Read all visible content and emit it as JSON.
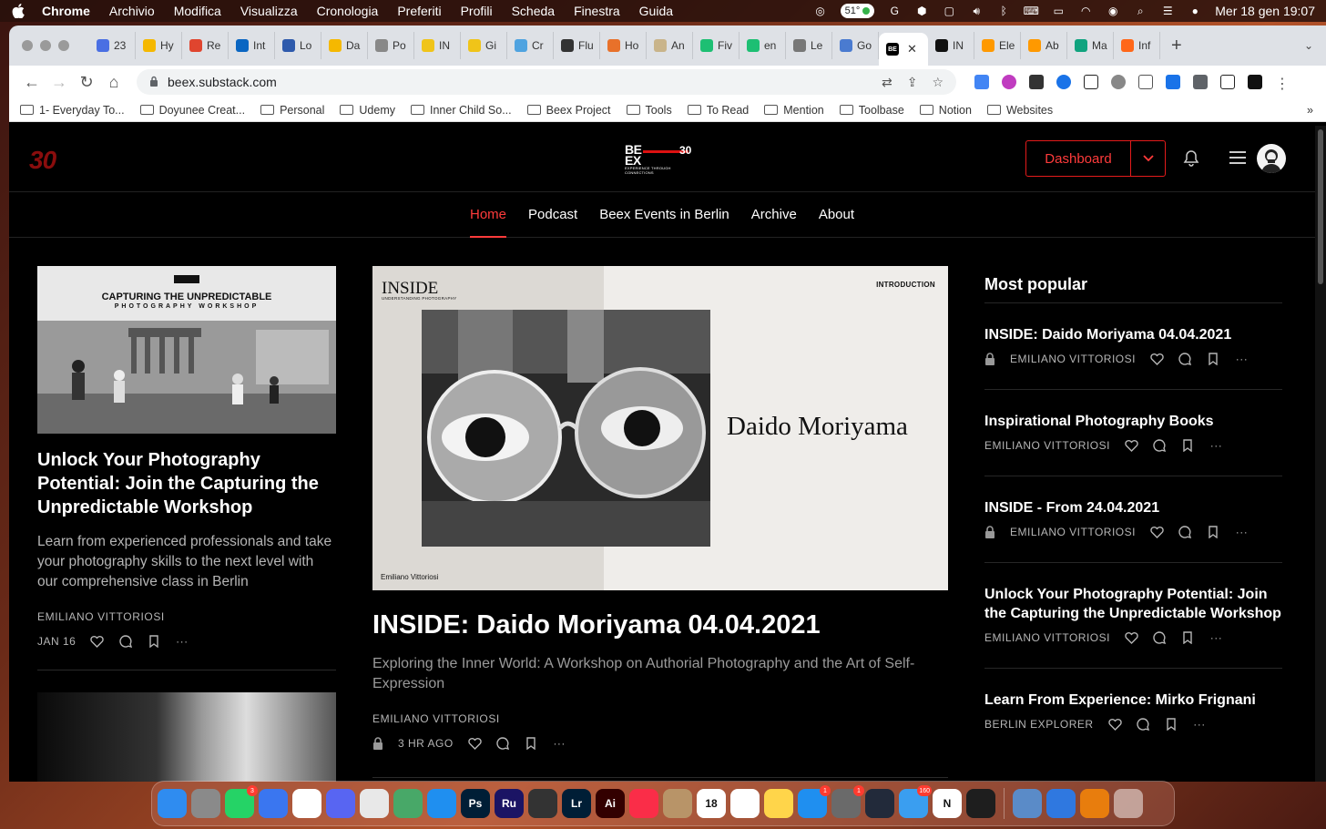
{
  "menubar": {
    "app": "Chrome",
    "items": [
      "Archivio",
      "Modifica",
      "Visualizza",
      "Cronologia",
      "Preferiti",
      "Profili",
      "Scheda",
      "Finestra",
      "Guida"
    ],
    "temperature": "51°",
    "datetime": "Mer 18 gen  19:07"
  },
  "tabs": [
    {
      "label": "23",
      "color": "#4a6fe3"
    },
    {
      "label": "Hy",
      "color": "#f5b800"
    },
    {
      "label": "Re",
      "color": "#e0452f"
    },
    {
      "label": "Int",
      "color": "#0a66c2"
    },
    {
      "label": "Lo",
      "color": "#2e5aac"
    },
    {
      "label": "Da",
      "color": "#f5b800"
    },
    {
      "label": "Po",
      "color": "#888888"
    },
    {
      "label": "IN",
      "color": "#f0c419"
    },
    {
      "label": "Gi",
      "color": "#f0c419"
    },
    {
      "label": "Cr",
      "color": "#4fa3e0"
    },
    {
      "label": "Flu",
      "color": "#333333"
    },
    {
      "label": "Ho",
      "color": "#e8712a"
    },
    {
      "label": "An",
      "color": "#c9b48a"
    },
    {
      "label": "Fiv",
      "color": "#1dbf73"
    },
    {
      "label": "en",
      "color": "#1dbf73"
    },
    {
      "label": "Le",
      "color": "#777777"
    },
    {
      "label": "Go",
      "color": "#4a7bd0"
    }
  ],
  "active_tab": {
    "label": "BE EX"
  },
  "tabs_after": [
    {
      "label": "IN",
      "color": "#111111"
    },
    {
      "label": "Ele",
      "color": "#ff9900"
    },
    {
      "label": "Ab",
      "color": "#ff9900"
    },
    {
      "label": "Ma",
      "color": "#10a37f"
    },
    {
      "label": "Inf",
      "color": "#ff6719"
    }
  ],
  "address": "beex.substack.com",
  "bookmarks": [
    {
      "label": "1- Everyday To..."
    },
    {
      "label": "Doyunee Creat..."
    },
    {
      "label": "Personal"
    },
    {
      "label": "Udemy"
    },
    {
      "label": "Inner Child So..."
    },
    {
      "label": "Beex Project"
    },
    {
      "label": "Tools"
    },
    {
      "label": "To Read"
    },
    {
      "label": "Mention"
    },
    {
      "label": "Toolbase"
    },
    {
      "label": "Notion"
    },
    {
      "label": "Websites"
    }
  ],
  "site": {
    "side_logo": "30",
    "logo_be": "BE",
    "logo_ex": "EX",
    "logo_num": "30",
    "logo_tag": "EXPERIENCE THROUGH CONNECTIONS",
    "dashboard": "Dashboard",
    "nav": [
      "Home",
      "Podcast",
      "Beex Events in Berlin",
      "Archive",
      "About"
    ],
    "accent": "#ff3b3b"
  },
  "left_post": {
    "image_title": "CAPTURING THE UNPREDICTABLE",
    "image_subtitle": "PHOTOGRAPHY WORKSHOP",
    "title": "Unlock Your Photography Potential: Join the Capturing the Unpredictable Workshop",
    "description": "Learn from experienced professionals and take your photography skills to the next level with our comprehensive class in Berlin",
    "author": "EMILIANO VITTORIOSI",
    "date": "JAN 16"
  },
  "feature_post": {
    "image_brand": "INSIDE",
    "image_brand_sub": "UNDERSTANDING PHOTOGRAPHY",
    "image_tag": "INTRODUCTION",
    "image_name": "Daido Moriyama",
    "image_author": "Emiliano Vittoriosi",
    "title": "INSIDE: Daido Moriyama 04.04.2021",
    "description": "Exploring the Inner World: A Workshop on Authorial Photography and the Art of Self-Expression",
    "author": "EMILIANO VITTORIOSI",
    "time": "3 HR AGO"
  },
  "most_popular": {
    "heading": "Most popular",
    "items": [
      {
        "title": "INSIDE: Daido Moriyama 04.04.2021",
        "author": "EMILIANO VITTORIOSI",
        "locked": true
      },
      {
        "title": "Inspirational Photography Books",
        "author": "EMILIANO VITTORIOSI",
        "locked": false
      },
      {
        "title": "INSIDE - From 24.04.2021",
        "author": "EMILIANO VITTORIOSI",
        "locked": true
      },
      {
        "title": "Unlock Your Photography Potential: Join the Capturing the Unpredictable Workshop",
        "author": "EMILIANO VITTORIOSI",
        "locked": false
      },
      {
        "title": "Learn From Experience: Mirko Frignani",
        "author": "BERLIN EXPLORER",
        "locked": false
      }
    ]
  },
  "dock": {
    "apps": [
      {
        "name": "finder",
        "color": "#2f8cf0",
        "text": ""
      },
      {
        "name": "launchpad",
        "color": "#8a8a8a",
        "text": ""
      },
      {
        "name": "whatsapp",
        "color": "#25d366",
        "text": "",
        "badge": "3"
      },
      {
        "name": "signal",
        "color": "#3a76f0",
        "text": ""
      },
      {
        "name": "slack",
        "color": "#ffffff",
        "text": ""
      },
      {
        "name": "discord",
        "color": "#5865f2",
        "text": ""
      },
      {
        "name": "chrome",
        "color": "#e8e8e8",
        "text": ""
      },
      {
        "name": "maps",
        "color": "#48a868",
        "text": ""
      },
      {
        "name": "safari",
        "color": "#1f8ff0",
        "text": ""
      },
      {
        "name": "photoshop",
        "color": "#001e36",
        "text": "Ps"
      },
      {
        "name": "rush",
        "color": "#1b1464",
        "text": "Ru"
      },
      {
        "name": "final-cut",
        "color": "#333333",
        "text": ""
      },
      {
        "name": "lightroom",
        "color": "#001e36",
        "text": "Lr"
      },
      {
        "name": "illustrator",
        "color": "#330000",
        "text": "Ai"
      },
      {
        "name": "music",
        "color": "#fa2d48",
        "text": ""
      },
      {
        "name": "contacts",
        "color": "#b89468",
        "text": ""
      },
      {
        "name": "calendar",
        "color": "#ffffff",
        "text": "18"
      },
      {
        "name": "reminders",
        "color": "#ffffff",
        "text": ""
      },
      {
        "name": "notes",
        "color": "#ffd54a",
        "text": ""
      },
      {
        "name": "app-store",
        "color": "#1f8ff0",
        "text": "",
        "badge": "1"
      },
      {
        "name": "system-settings",
        "color": "#6a6a6a",
        "text": "",
        "badge": "1"
      },
      {
        "name": "linear",
        "color": "#222a3a",
        "text": ""
      },
      {
        "name": "mail",
        "color": "#3a9ef0",
        "text": "",
        "badge": "160"
      },
      {
        "name": "notion",
        "color": "#ffffff",
        "text": "N"
      },
      {
        "name": "figma",
        "color": "#1e1e1e",
        "text": ""
      }
    ],
    "after_sep": [
      {
        "name": "preview",
        "color": "#5a8bc8",
        "text": ""
      },
      {
        "name": "xcode-tool",
        "color": "#2f78e0",
        "text": ""
      },
      {
        "name": "blender",
        "color": "#e87d0d",
        "text": ""
      }
    ]
  }
}
